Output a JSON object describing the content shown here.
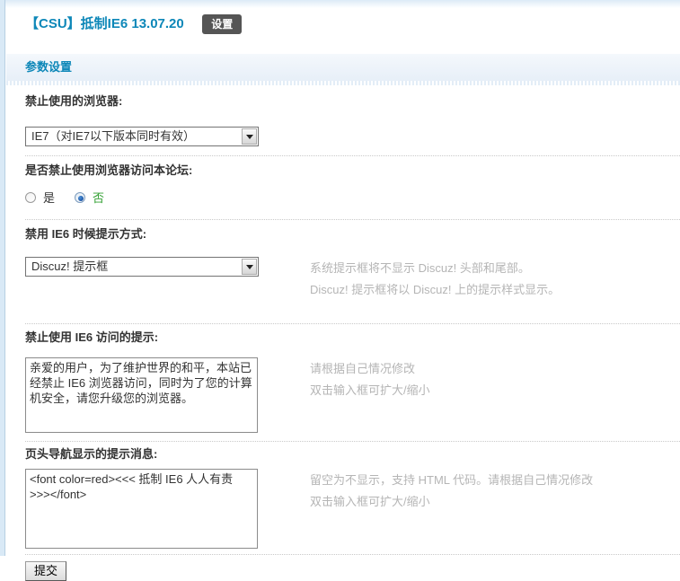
{
  "header": {
    "title": "【CSU】抵制IE6 13.07.20",
    "settings_button": "设置"
  },
  "section": {
    "title": "参数设置"
  },
  "fields": [
    {
      "label": "禁止使用的浏览器:",
      "type": "select",
      "value": "IE7（对IE7以下版本同时有效）"
    },
    {
      "label": "是否禁止使用浏览器访问本论坛:",
      "type": "radio",
      "options": [
        {
          "label": "是",
          "checked": false
        },
        {
          "label": "否",
          "checked": true
        }
      ]
    },
    {
      "label": "禁用 IE6 时候提示方式:",
      "type": "select",
      "value": "Discuz! 提示框",
      "hints": [
        "系统提示框将不显示 Discuz! 头部和尾部。",
        "Discuz! 提示框将以 Discuz! 上的提示样式显示。"
      ]
    },
    {
      "label": "禁止使用 IE6 访问的提示:",
      "type": "textarea",
      "value": "亲爱的用户，为了维护世界的和平，本站已经禁止 IE6 浏览器访问，同时为了您的计算机安全，请您升级您的浏览器。",
      "hints": [
        "请根据自己情况修改",
        "双击输入框可扩大/缩小"
      ]
    },
    {
      "label": "页头导航显示的提示消息:",
      "type": "textarea",
      "value": "<font color=red><<< 抵制 IE6 人人有责 >>></font>",
      "hints": [
        "留空为不显示，支持 HTML 代码。请根据自己情况修改",
        "双击输入框可扩大/缩小"
      ]
    }
  ],
  "submit": {
    "label": "提交"
  },
  "colors": {
    "accent_title": "#0d87b8",
    "settings_button_bg": "#555555",
    "option_no_green": "#33a033",
    "hint_text": "#b5b5b5",
    "left_strip": "#d9e9f6"
  }
}
